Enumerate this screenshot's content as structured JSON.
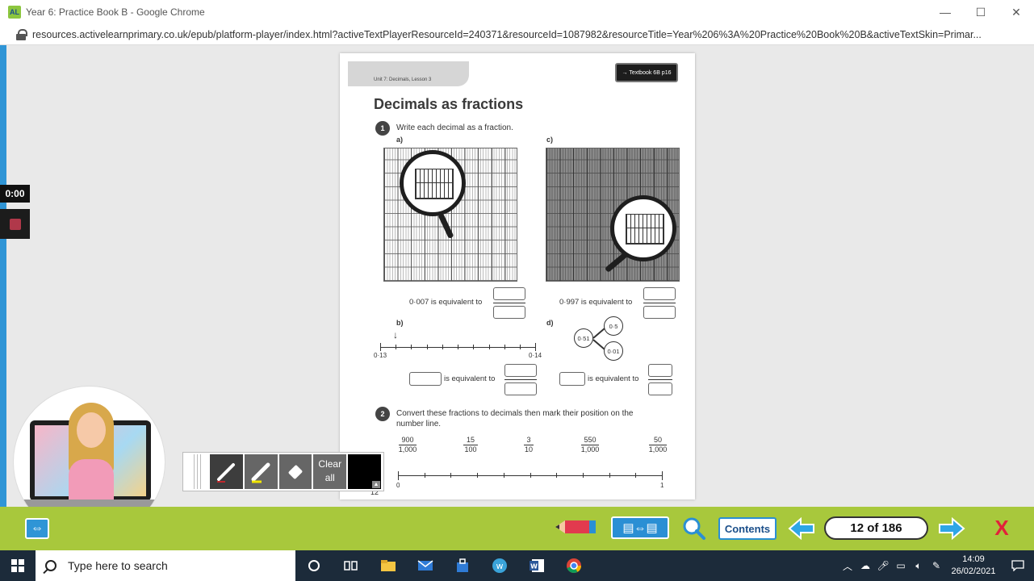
{
  "window": {
    "app_logo": "AL",
    "title": "Year 6: Practice Book B - Google Chrome",
    "minimize": "—",
    "maximize": "☐",
    "close": "✕"
  },
  "address": {
    "url": "resources.activelearnprimary.co.uk/epub/platform-player/index.html?activeTextPlayerResourceId=240371&resourceId=1087982&resourceTitle=Year%206%3A%20Practice%20Book%20B&activeTextSkin=Primar..."
  },
  "recorder": {
    "time": "0:00"
  },
  "book": {
    "unit": "Unit 7: Decimals, Lesson 3",
    "textbook_ref": "→ Textbook 6B p16",
    "heading": "Decimals as fractions",
    "q1": {
      "num": "1",
      "text": "Write each decimal as a fraction.",
      "a": {
        "label": "a)",
        "statement": "0·007 is equivalent to"
      },
      "b": {
        "label": "b)",
        "arrow": "↓",
        "start": "0·13",
        "end": "0·14",
        "statement": "is equivalent to"
      },
      "c": {
        "label": "c)",
        "statement": "0·997 is equivalent to"
      },
      "d": {
        "label": "d)",
        "whole": "0·51",
        "part1": "0·5",
        "part2": "0·01",
        "statement": "is equivalent to"
      }
    },
    "q2": {
      "num": "2",
      "text": "Convert these fractions to decimals then mark their position on the number line.",
      "fractions": [
        {
          "num": "900",
          "den": "1,000"
        },
        {
          "num": "15",
          "den": "100"
        },
        {
          "num": "3",
          "den": "10"
        },
        {
          "num": "550",
          "den": "1,000"
        },
        {
          "num": "50",
          "den": "1,000"
        }
      ],
      "line_start": "0",
      "line_end": "1"
    },
    "page_number": "12"
  },
  "draw_toolbar": {
    "clear_label": "Clear all"
  },
  "bottom_bar": {
    "contents_label": "Contents",
    "page_indicator": "12 of 186",
    "close_label": "X"
  },
  "taskbar": {
    "search_placeholder": "Type here to search",
    "time": "14:09",
    "date": "26/02/2021"
  }
}
